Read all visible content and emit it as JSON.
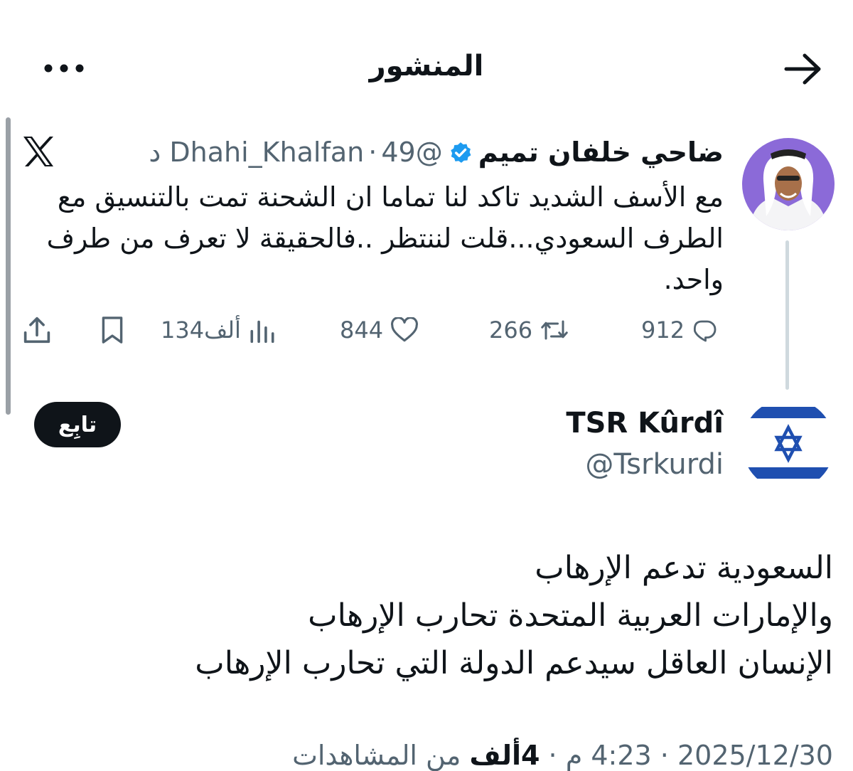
{
  "header": {
    "title": "المنشور",
    "back_icon": "arrow-right-icon",
    "more_icon": "more-horizontal-icon"
  },
  "quoted_tweet": {
    "author_name": "ضاحي خلفان تميم",
    "handle": "@Dhahi_Khalfan",
    "separator": "·",
    "time": "49 د",
    "platform_icon": "x-logo-icon",
    "text": "مع الأسف الشديد تاكد لنا تماما ان الشحنة تمت بالتنسيق مع الطرف السعودي...قلت لننتظر ..فالحقيقة لا تعرف من طرف واحد.",
    "stats": {
      "replies": "912",
      "reposts": "266",
      "likes": "844",
      "views": "134ألف"
    },
    "colors": {
      "verified": "#1d9bf0",
      "avatar_bg": "#8b6ad8"
    }
  },
  "main_tweet": {
    "author_name": "TSR Kûrdî",
    "handle": "@Tsrkurdi",
    "follow_label": "تابِع",
    "avatar_colors": {
      "flag_blue": "#1f4fb0",
      "flag_white": "#ffffff"
    },
    "text_lines": [
      "السعودية تدعم الإرهاب",
      "والإمارات العربية المتحدة تحارب الإرهاب",
      "الإنسان العاقل سيدعم الدولة التي تحارب الإرهاب"
    ],
    "timestamp": {
      "time": "4:23 م",
      "sep1": "·",
      "date": "2025/12/30",
      "sep2": "·",
      "views_count": "4ألف",
      "views_label": "من المشاهدات"
    }
  }
}
